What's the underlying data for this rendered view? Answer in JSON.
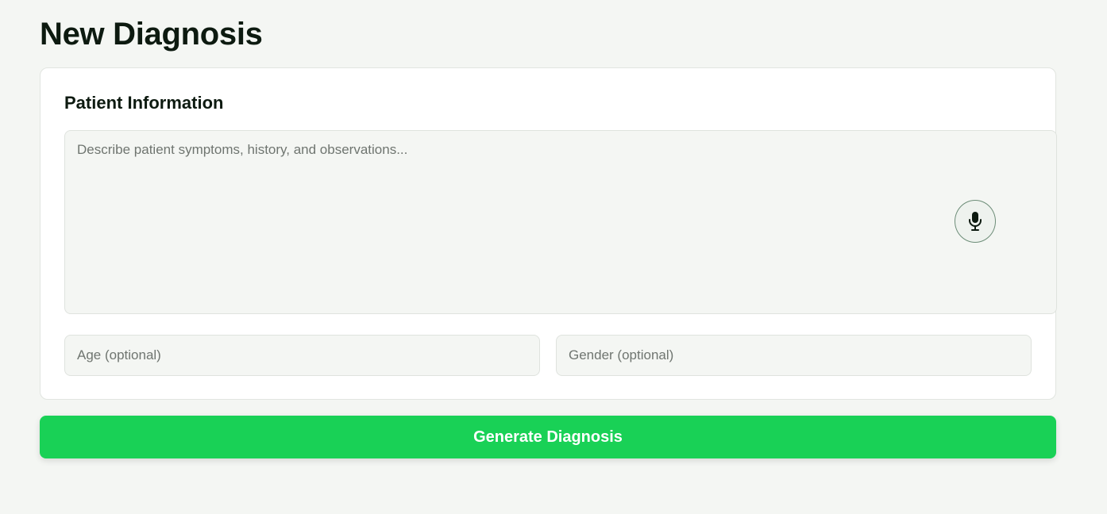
{
  "page": {
    "title": "New Diagnosis"
  },
  "patient_card": {
    "title": "Patient Information",
    "symptoms_placeholder": "Describe patient symptoms, history, and observations...",
    "symptoms_value": "",
    "mic_icon": "microphone-icon",
    "age_placeholder": "Age (optional)",
    "age_value": "",
    "gender_placeholder": "Gender (optional)",
    "gender_value": ""
  },
  "actions": {
    "generate_label": "Generate Diagnosis"
  },
  "colors": {
    "accent": "#19d156",
    "background": "#f4f6f3",
    "card": "#ffffff",
    "text": "#0d1a10"
  }
}
